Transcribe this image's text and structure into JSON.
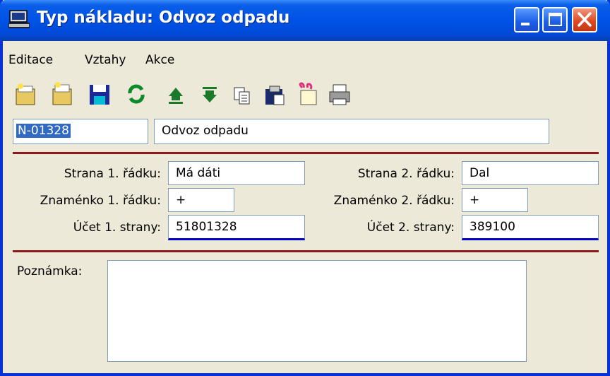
{
  "window": {
    "title": "Typ nákladu: Odvoz odpadu",
    "title_bar_color": "#0052e6",
    "close_button_color": "#df4a24"
  },
  "menu": [
    "Editace",
    "Vztahy",
    "Akce"
  ],
  "toolbar": {
    "icons": [
      "new-record-icon",
      "copy-record-icon",
      "save-icon",
      "refresh-icon",
      "move-up-icon",
      "move-down-icon",
      "copy-icon",
      "paste-icon",
      "filter-icon",
      "print-icon"
    ]
  },
  "header": {
    "code": "N-01328",
    "name": "Odvoz odpadu"
  },
  "form": {
    "strana1_label": "Strana 1. řádku:",
    "strana1_value": "Má dáti",
    "strana2_label": "Strana 2. řádku:",
    "strana2_value": "Dal",
    "znamenko1_label": "Znaménko 1. řádku:",
    "znamenko1_value": "+",
    "znamenko2_label": "Znaménko 2. řádku:",
    "znamenko2_value": "+",
    "ucet1_label": "Účet 1. strany:",
    "ucet1_value": "51801328",
    "ucet2_label": "Účet 2. strany:",
    "ucet2_value": "389100"
  },
  "note": {
    "label": "Poznámka:",
    "value": ""
  },
  "colors": {
    "separator": "#8b1a1a",
    "window_bg": "#ece9d8",
    "account_underline": "#0000c8"
  }
}
